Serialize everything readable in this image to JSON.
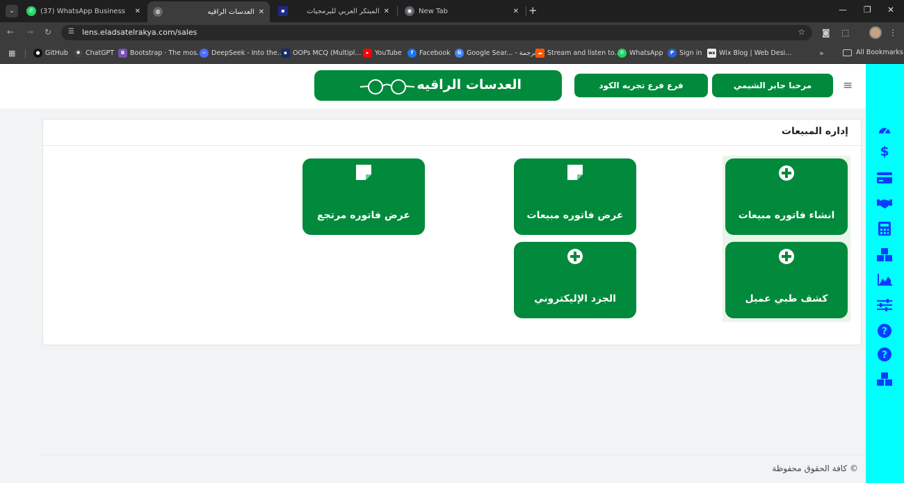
{
  "browser": {
    "tabs": [
      {
        "title": "(37) WhatsApp Business",
        "icon": "whatsapp-icon",
        "active": false
      },
      {
        "title": "العدسات الراقيه",
        "icon": "globe-icon",
        "active": true
      },
      {
        "title": "المبتكر العربي للبرمجيات",
        "icon": "app-icon",
        "active": false
      },
      {
        "title": "New Tab",
        "icon": "chrome-icon",
        "active": false
      }
    ],
    "url": "lens.eladsatelrakya.com/sales",
    "bookmarks": [
      {
        "label": "GitHub",
        "icon": "github-icon",
        "color": "#111111"
      },
      {
        "label": "ChatGPT",
        "icon": "chatgpt-icon",
        "color": "#444444"
      },
      {
        "label": "Bootstrap · The mos...",
        "icon": "bootstrap-icon",
        "color": "#7952b3"
      },
      {
        "label": "DeepSeek - Into the...",
        "icon": "deepseek-icon",
        "color": "#4d6bfe"
      },
      {
        "label": "OOPs MCQ (Multipl...",
        "icon": "oops-icon",
        "color": "#1a2a6c"
      },
      {
        "label": "YouTube",
        "icon": "youtube-icon",
        "color": "#ff0000"
      },
      {
        "label": "Facebook",
        "icon": "facebook-icon",
        "color": "#1877f2"
      },
      {
        "label": "Google Sear... - ترجمة",
        "icon": "google-icon",
        "color": "#4285f4"
      },
      {
        "label": "Stream and listen to...",
        "icon": "soundcloud-icon",
        "color": "#ff5500"
      },
      {
        "label": "WhatsApp",
        "icon": "whatsapp-icon",
        "color": "#25d366"
      },
      {
        "label": "Sign in",
        "icon": "paypal-icon",
        "color": "#2a62d8"
      },
      {
        "label": "Wix Blog | Web Desi...",
        "icon": "wix-icon",
        "color": "#333333"
      }
    ],
    "all_bookmarks": "All Bookmarks"
  },
  "header": {
    "logo_text": "العدسات الراقيه",
    "branch_button": "فرع فرع تجربه الكود",
    "welcome_button": "مرحبا جابر الشيمي"
  },
  "card": {
    "title": "إداره المبيعات"
  },
  "tiles": [
    {
      "label": "انشاء فاتوره مبيعات",
      "icon": "plus-circle-icon"
    },
    {
      "label": "عرض فاتوره مبيعات",
      "icon": "note-icon"
    },
    {
      "label": "عرض فاتوره مرتجع",
      "icon": "note-icon"
    },
    {
      "label": "كشف طبي عميل",
      "icon": "plus-circle-icon"
    },
    {
      "label": "الجرد الإليكتروني",
      "icon": "plus-circle-icon"
    }
  ],
  "sidebar_icons": [
    "dashboard-icon",
    "dollar-icon",
    "credit-card-icon",
    "handshake-icon",
    "calculator-icon",
    "boxes-icon",
    "area-chart-icon",
    "sliders-icon",
    "question-circle-icon",
    "question-circle-icon",
    "boxes-icon"
  ],
  "colors": {
    "primary_green": "#018a3b",
    "sidebar_cyan": "#00ffff",
    "sidebar_icon_blue": "#0a3cff"
  },
  "footer": {
    "copyright": "© كافة الحقوق محفوظة"
  }
}
